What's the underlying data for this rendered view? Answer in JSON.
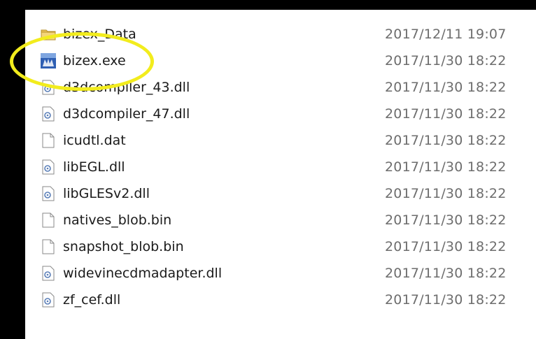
{
  "colors": {
    "background_border": "#000000",
    "panel": "#ffffff",
    "filename_text": "#1a1a1a",
    "date_text": "#6d6d6d",
    "highlight_ring": "#f2ec1d",
    "folder_yellow": "#e8c25a",
    "exe_blue": "#2f5fb3"
  },
  "files": [
    {
      "name": "bizex_Data",
      "modified": "2017/12/11 19:07",
      "icon": "folder-icon"
    },
    {
      "name": "bizex.exe",
      "modified": "2017/11/30 18:22",
      "icon": "application-icon"
    },
    {
      "name": "d3dcompiler_43.dll",
      "modified": "2017/11/30 18:22",
      "icon": "dll-icon"
    },
    {
      "name": "d3dcompiler_47.dll",
      "modified": "2017/11/30 18:22",
      "icon": "dll-icon"
    },
    {
      "name": "icudtl.dat",
      "modified": "2017/11/30 18:22",
      "icon": "file-icon"
    },
    {
      "name": "libEGL.dll",
      "modified": "2017/11/30 18:22",
      "icon": "dll-icon"
    },
    {
      "name": "libGLESv2.dll",
      "modified": "2017/11/30 18:22",
      "icon": "dll-icon"
    },
    {
      "name": "natives_blob.bin",
      "modified": "2017/11/30 18:22",
      "icon": "file-icon"
    },
    {
      "name": "snapshot_blob.bin",
      "modified": "2017/11/30 18:22",
      "icon": "file-icon"
    },
    {
      "name": "widevinecdmadapter.dll",
      "modified": "2017/11/30 18:22",
      "icon": "dll-icon"
    },
    {
      "name": "zf_cef.dll",
      "modified": "2017/11/30 18:22",
      "icon": "dll-icon"
    }
  ]
}
